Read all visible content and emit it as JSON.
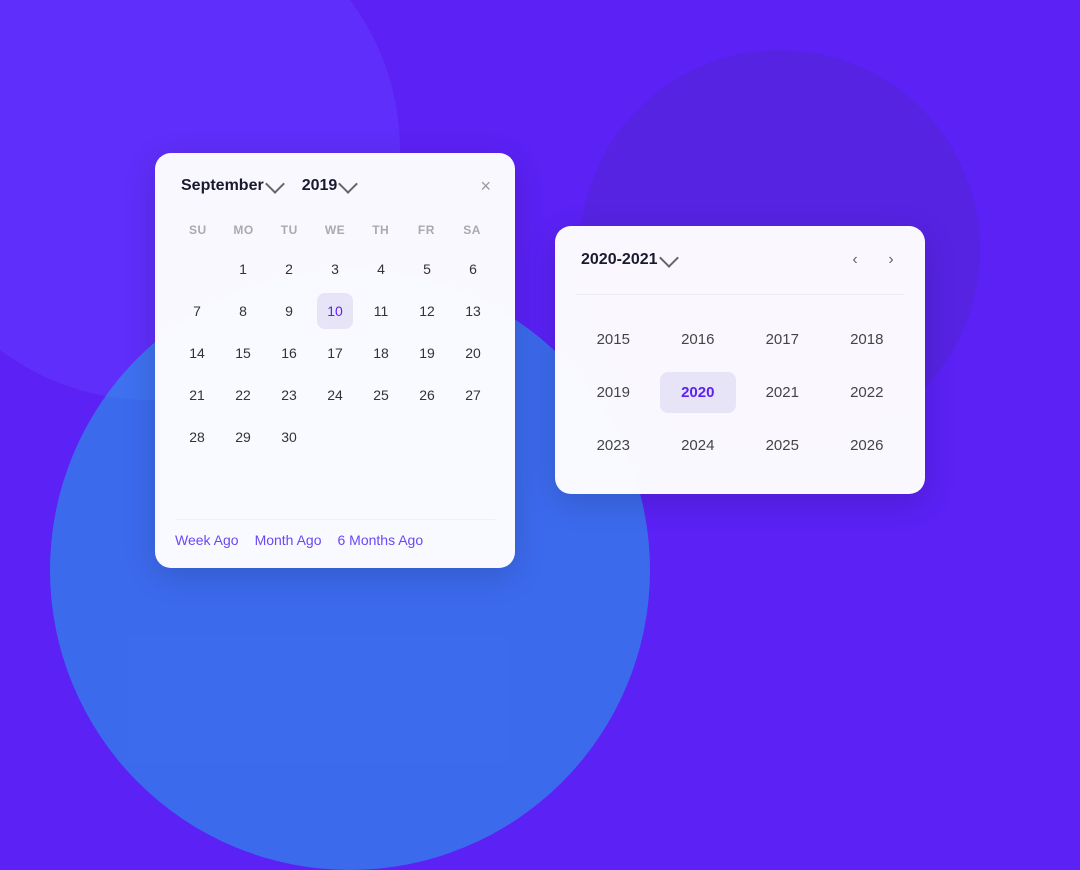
{
  "background": {
    "color": "#5b21f5"
  },
  "calendar": {
    "month_label": "September",
    "year_label": "2019",
    "close_icon": "×",
    "weekdays": [
      "SU",
      "MO",
      "TU",
      "WE",
      "TH",
      "FR",
      "SA"
    ],
    "days": [
      {
        "day": "",
        "empty": true
      },
      {
        "day": "1"
      },
      {
        "day": "2"
      },
      {
        "day": "3"
      },
      {
        "day": "4"
      },
      {
        "day": "5"
      },
      {
        "day": "6"
      },
      {
        "day": "7"
      },
      {
        "day": "8"
      },
      {
        "day": "9"
      },
      {
        "day": "10",
        "selected": true
      },
      {
        "day": "11"
      },
      {
        "day": "12"
      },
      {
        "day": "13"
      },
      {
        "day": "14"
      },
      {
        "day": "15"
      },
      {
        "day": "16"
      },
      {
        "day": "17"
      },
      {
        "day": "18"
      },
      {
        "day": "19"
      },
      {
        "day": "20"
      },
      {
        "day": "21"
      },
      {
        "day": "22"
      },
      {
        "day": "23"
      },
      {
        "day": "24"
      },
      {
        "day": "25"
      },
      {
        "day": "26"
      },
      {
        "day": "27"
      },
      {
        "day": "28"
      },
      {
        "day": "29"
      },
      {
        "day": "30"
      },
      {
        "day": "",
        "empty": true
      },
      {
        "day": "",
        "empty": true
      },
      {
        "day": "",
        "empty": true
      },
      {
        "day": "",
        "empty": true
      },
      {
        "day": "",
        "empty": true
      }
    ],
    "quick_links": [
      {
        "label": "Week Ago",
        "key": "week-ago"
      },
      {
        "label": "Month Ago",
        "key": "month-ago"
      },
      {
        "label": "6 Months Ago",
        "key": "6-months-ago"
      }
    ]
  },
  "year_picker": {
    "range_label": "2020-2021",
    "prev_icon": "‹",
    "next_icon": "›",
    "years": [
      {
        "year": "2015"
      },
      {
        "year": "2016"
      },
      {
        "year": "2017"
      },
      {
        "year": "2018"
      },
      {
        "year": "2019"
      },
      {
        "year": "2020",
        "selected": true
      },
      {
        "year": "2021"
      },
      {
        "year": "2022"
      },
      {
        "year": "2023"
      },
      {
        "year": "2024"
      },
      {
        "year": "2025"
      },
      {
        "year": "2026"
      }
    ]
  }
}
